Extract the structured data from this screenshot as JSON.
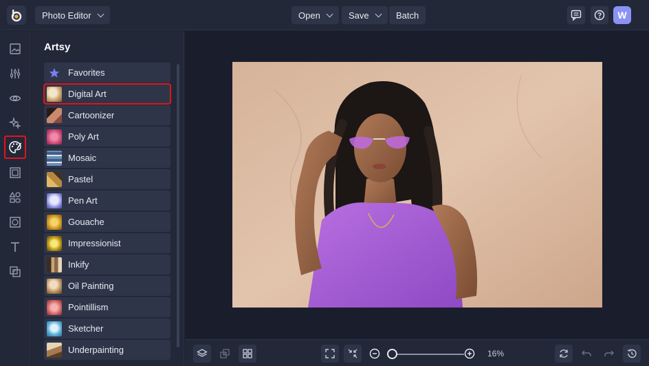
{
  "topbar": {
    "app_menu_label": "Photo Editor",
    "open_label": "Open",
    "save_label": "Save",
    "batch_label": "Batch",
    "avatar_initial": "W"
  },
  "rail": {
    "items": [
      "image-icon",
      "sliders-icon",
      "eye-icon",
      "sparkle-icon",
      "palette-icon",
      "frame-icon",
      "shapes-icon",
      "texture-icon",
      "text-icon",
      "overlay-icon"
    ],
    "active": "palette-icon"
  },
  "panel": {
    "title": "Artsy",
    "items": [
      {
        "label": "Favorites",
        "thumb": "#6f7cf0"
      },
      {
        "label": "Digital Art",
        "thumb": "#c9a36a"
      },
      {
        "label": "Cartoonizer",
        "thumb": "#8b4a3c"
      },
      {
        "label": "Poly Art",
        "thumb": "#d04f7a"
      },
      {
        "label": "Mosaic",
        "thumb": "#6a8fb8"
      },
      {
        "label": "Pastel",
        "thumb": "#b8873e"
      },
      {
        "label": "Pen Art",
        "thumb": "#7c7fd6"
      },
      {
        "label": "Gouache",
        "thumb": "#d9a22b"
      },
      {
        "label": "Impressionist",
        "thumb": "#c7a21c"
      },
      {
        "label": "Inkify",
        "thumb": "#8a6a48"
      },
      {
        "label": "Oil Painting",
        "thumb": "#b8905e"
      },
      {
        "label": "Pointillism",
        "thumb": "#d46a6a"
      },
      {
        "label": "Sketcher",
        "thumb": "#5aaed8"
      },
      {
        "label": "Underpainting",
        "thumb": "#a6794f"
      }
    ],
    "selected": "Digital Art"
  },
  "bottombar": {
    "zoom_label": "16%",
    "zoom_fraction": 0.0
  },
  "colors": {
    "accent": "#8a93f5",
    "highlight": "#e3141b",
    "background": "#1d2130",
    "panel": "#232839"
  }
}
